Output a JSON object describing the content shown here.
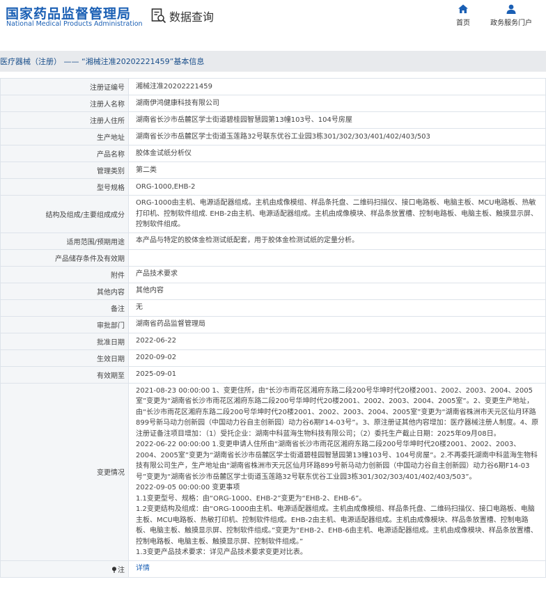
{
  "header": {
    "logo_cn": "国家药品监督管理局",
    "logo_en": "National Medical Products Administration",
    "query_label": "数据查询",
    "nav": [
      {
        "label": "首页",
        "icon": "home-icon"
      },
      {
        "label": "政务服务门户",
        "icon": "user-icon"
      }
    ]
  },
  "breadcrumb": "医疗器械（注册） —— “湘械注准20202221459”基本信息",
  "rows": [
    {
      "label": "注册证编号",
      "value": "湘械注准20202221459"
    },
    {
      "label": "注册人名称",
      "value": "湖南伊鸿健康科技有限公司"
    },
    {
      "label": "注册人住所",
      "value": "湖南省长沙市岳麓区学士街道碧桂园智慧园第13幢103号、104号房屋"
    },
    {
      "label": "生产地址",
      "value": "湖南省长沙市岳麓区学士街道玉莲路32号联东优谷工业园3栋301/302/303/401/402/403/503"
    },
    {
      "label": "产品名称",
      "value": "胶体金试纸分析仪"
    },
    {
      "label": "管理类别",
      "value": "第二类"
    },
    {
      "label": "型号规格",
      "value": "ORG-1000,EHB-2"
    },
    {
      "label": "结构及组成/主要组成成分",
      "value": "ORG-1000由主机、电源适配器组成。主机由成像模组、样品条托盘、二维码扫描仪、接口电路板、电脑主板、MCU电路板、热敏打印机、控制软件组成. EHB-2由主机、电源适配器组成。主机由成像模块、样品条放置槽、控制电路板、电脑主板、触摸显示屏、控制软件组成。"
    },
    {
      "label": "适用范围/预期用途",
      "value": "本产品与特定的胶体金检测试纸配套，用于胶体金检测试纸的定量分析。"
    },
    {
      "label": "产品储存条件及有效期",
      "value": ""
    },
    {
      "label": "附件",
      "value": "产品技术要求"
    },
    {
      "label": "其他内容",
      "value": "其他内容"
    },
    {
      "label": "备注",
      "value": "无"
    },
    {
      "label": "审批部门",
      "value": "湖南省药品监督管理局"
    },
    {
      "label": "批准日期",
      "value": "2022-06-22"
    },
    {
      "label": "生效日期",
      "value": "2020-09-02"
    },
    {
      "label": "有效期至",
      "value": "2025-09-01"
    }
  ],
  "changes": {
    "label": "变更情况",
    "lines": [
      "2021-08-23 00:00:00 1、变更住所，由“长沙市雨花区湘府东路二段200号华坤时代20楼2001、2002、2003、2004、2005室”变更为“湖南省长沙市雨花区湘府东路二段200号华坤时代20楼2001、2002、2003、2004、2005室”。2、变更生产地址，由“长沙市雨花区湘府东路二段200号华坤时代20楼2001、2002、2003、2004、2005室”变更为“湖南省株洲市天元区仙月环路899号新马动力创新园（中国动力谷自主创新园）动力谷6期F14-03号”。3、原注册证其他内容增加：医疗器械注册人制度。4、原注册证备注项目增加：（1）受托企业：湖南中科蓝海生物科技有限公司；（2）委托生产截止日期：2025年09月08日。",
      "2022-06-22 00:00:00 1.变更申请人住所由“湖南省长沙市雨花区湘府东路二段200号华坤时代20楼2001、2002、2003、2004、2005室”变更为“湖南省长沙市岳麓区学士街道碧桂园智慧园第13幢103号、104号房屋”。2.不再委托湖南中科蓝海生物科技有限公司生产，生产地址由“湖南省株洲市天元区仙月环路899号新马动力创新园（中国动力谷自主创新园）动力谷6期F14-03号”变更为“湖南省长沙市岳麓区学士街道玉莲路32号联东优谷工业园3栋301/302/303/401/402/403/503”。",
      "2022-09-05 00:00:00 变更事项",
      "1.1变更型号、规格：由“ORG-1000、EHB-2”变更为“EHB-2、EHB-6”。",
      "1.2变更结构及组成：由“ORG-1000由主机、电源适配器组成。主机由成像模组、样品条托盘、二维码扫描仪、接口电路板、电脑主板、MCU电路板、热敏打印机、控制软件组成。EHB-2由主机、电源适配器组成。主机由成像模块、样品条放置槽、控制电路板、电脑主板、触摸显示屏、控制软件组成。”变更为“EHB-2、EHB-6由主机、电源适配器组成。主机由成像模块、样品条放置槽、控制电路板、电脑主板、触摸显示屏、控制软件组成。”",
      "1.3变更产品技术要求：详见产品技术要求变更对比表。"
    ]
  },
  "note": {
    "label": "注",
    "link": "详情",
    "icon": "pin-icon"
  },
  "colors": {
    "brand": "#1a5fb4",
    "breadcrumb_bg": "#e8eaed",
    "label_bg": "#f4f6f8",
    "border": "#dde3ea"
  }
}
